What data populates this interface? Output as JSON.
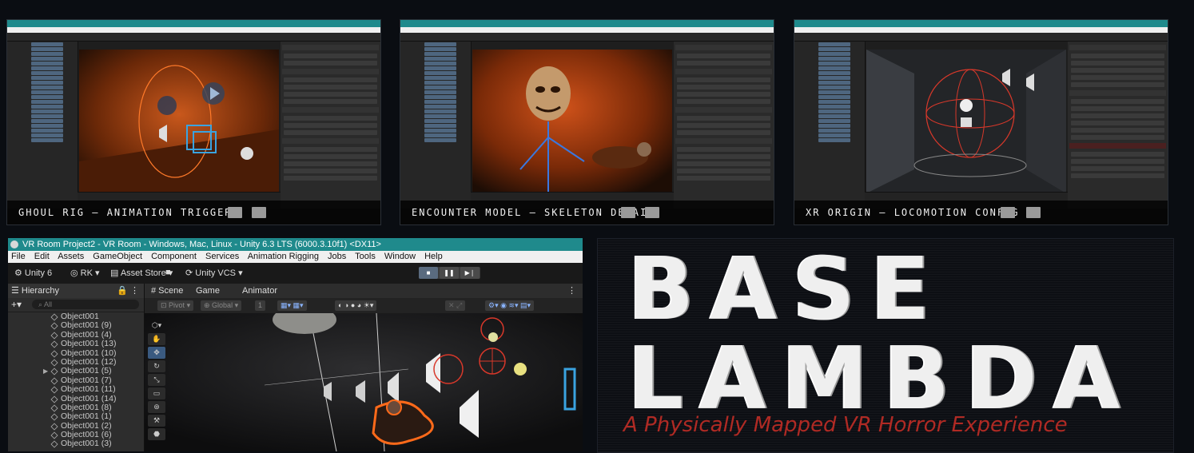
{
  "thumbnails": [
    {
      "caption": "GHOUL RIG — ANIMATION TRIGGERS"
    },
    {
      "caption": "ENCOUNTER MODEL — SKELETON DETAIL"
    },
    {
      "caption": "XR ORIGIN — LOCOMOTION CONFIG"
    }
  ],
  "editor": {
    "title": "VR Room Project2 - VR Room - Windows, Mac, Linux - Unity 6.3 LTS (6000.3.10f1) <DX11>",
    "menu": [
      "File",
      "Edit",
      "Assets",
      "GameObject",
      "Component",
      "Services",
      "Animation Rigging",
      "Jobs",
      "Tools",
      "Window",
      "Help"
    ],
    "toolbar": {
      "unity_label": "Unity 6",
      "account_label": "RK ▾",
      "asset_store_label": "Asset Store ▾",
      "vcs_label": "Unity VCS ▾"
    },
    "hierarchy": {
      "tab_label": "Hierarchy",
      "search_placeholder": "All",
      "items": [
        "Object001",
        "Object001 (9)",
        "Object001 (4)",
        "Object001 (13)",
        "Object001 (10)",
        "Object001 (12)",
        "Object001 (5)",
        "Object001 (7)",
        "Object001 (11)",
        "Object001 (14)",
        "Object001 (8)",
        "Object001 (1)",
        "Object001 (2)",
        "Object001 (6)",
        "Object001 (3)"
      ]
    },
    "scene": {
      "tabs": [
        "# Scene",
        "Game",
        "Animator"
      ],
      "pivot_label": "Pivot",
      "global_label": "Global",
      "grid_value": "1"
    }
  },
  "brand": {
    "line1": "BASE",
    "line2": "LAMBDA",
    "subtitle": "A Physically Mapped VR Horror Experience"
  },
  "colors": {
    "title_bar": "#1f8a8c",
    "accent_red": "#b02a24",
    "gizmo_orange": "#e0622a"
  }
}
